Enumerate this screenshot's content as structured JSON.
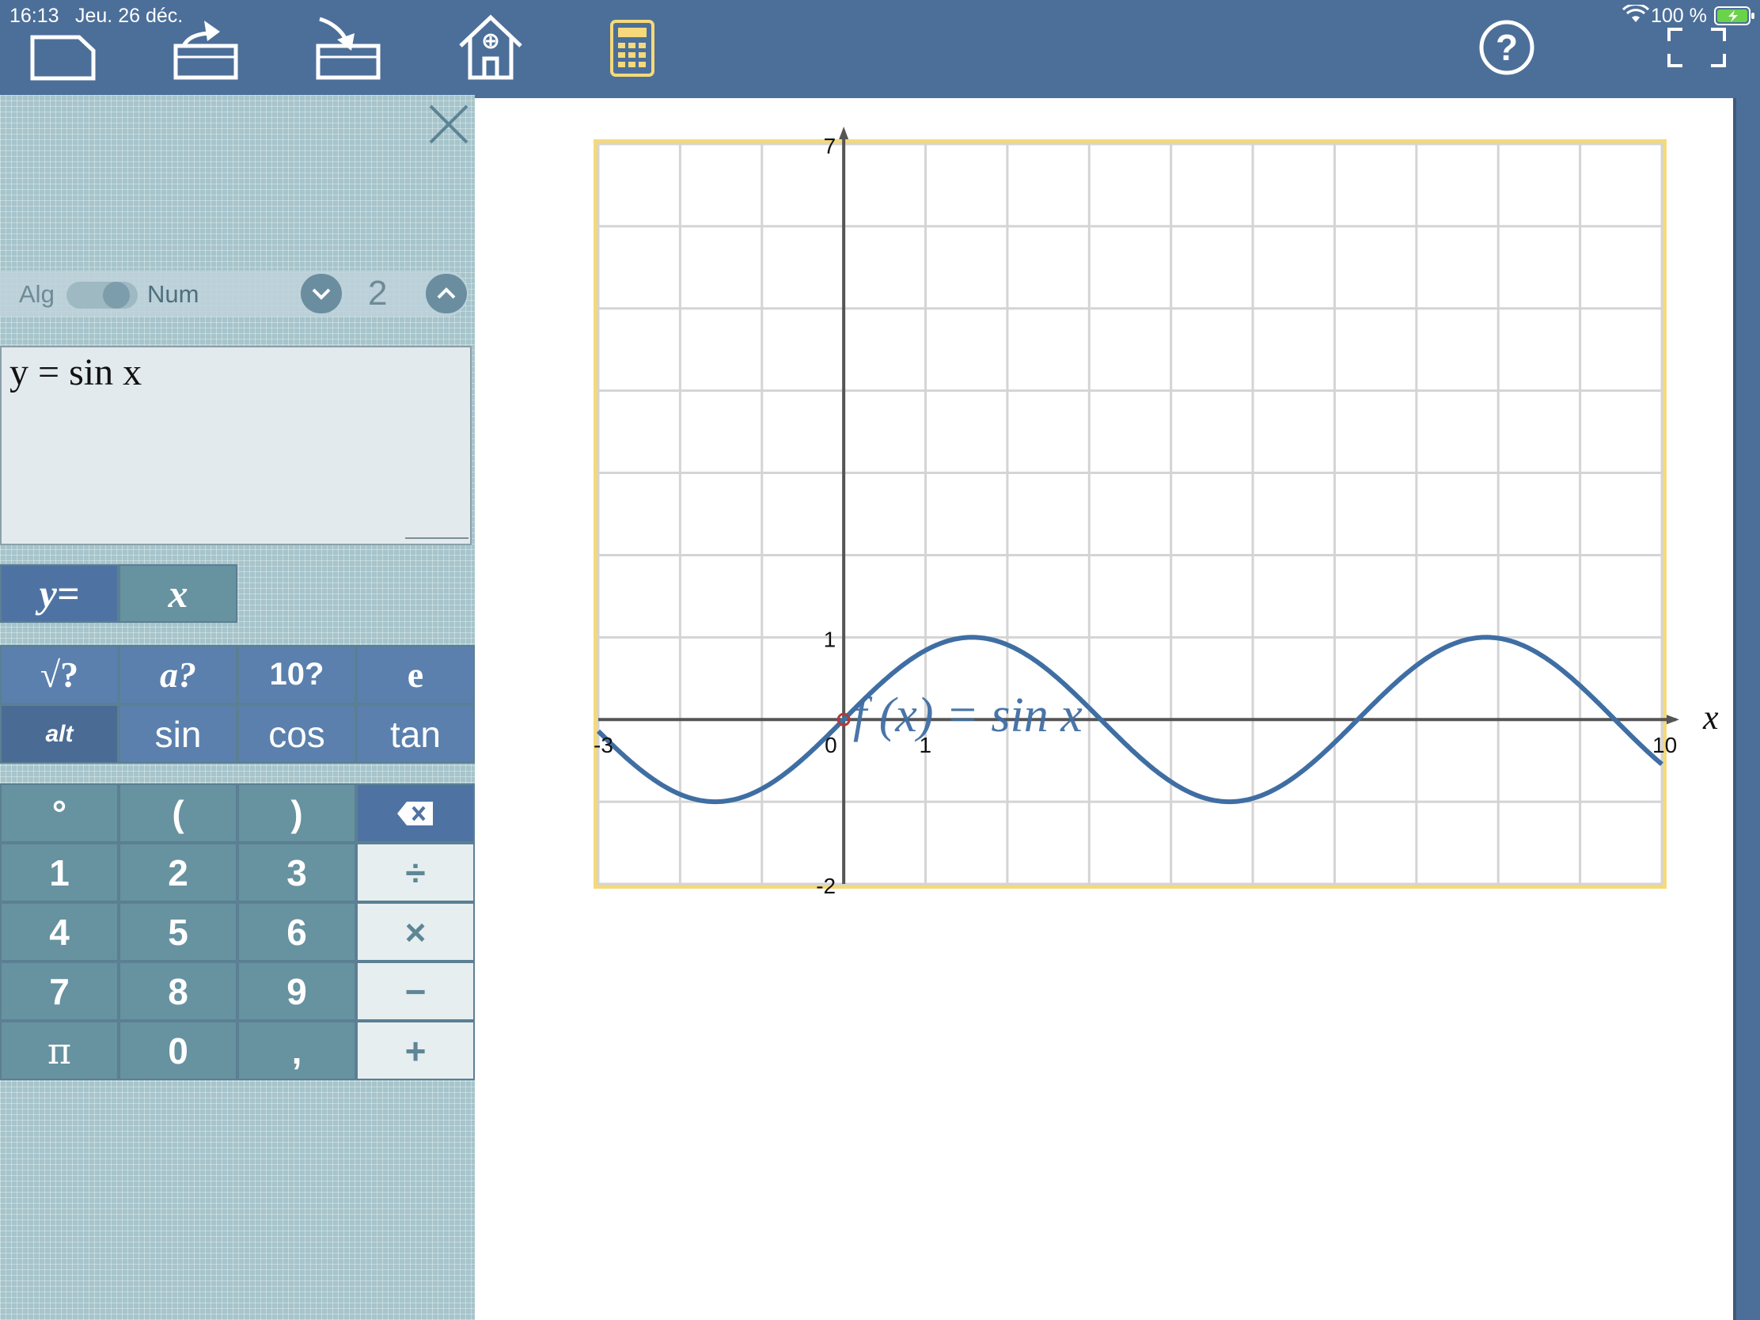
{
  "status_bar": {
    "time": "16:13",
    "date": "Jeu. 26 déc.",
    "battery": "100 %"
  },
  "toolbar": {
    "buttons": [
      "new-document",
      "export",
      "import",
      "home",
      "calculator",
      "help",
      "fullscreen"
    ],
    "help_glyph": "?"
  },
  "panel": {
    "mode_left": "Alg",
    "mode_right": "Num",
    "precision": "2",
    "expression": "y = sin x",
    "var_tabs": [
      "y=",
      "x"
    ]
  },
  "keypad": {
    "functions_row1": [
      "√?",
      "a?",
      "10?",
      "e"
    ],
    "functions_row2": [
      "alt",
      "sin",
      "cos",
      "tan"
    ],
    "rows": [
      [
        "°",
        "(",
        ")",
        "⌫"
      ],
      [
        "1",
        "2",
        "3",
        "÷"
      ],
      [
        "4",
        "5",
        "6",
        "×"
      ],
      [
        "7",
        "8",
        "9",
        "−"
      ],
      [
        "π",
        "0",
        ",",
        "+"
      ]
    ]
  },
  "chart_data": {
    "type": "line",
    "xlabel": "x",
    "xlim": [
      -3,
      10
    ],
    "ylim": [
      -2,
      7
    ],
    "x_tick_labels": [
      "-3",
      "0",
      "1",
      "10"
    ],
    "y_tick_labels": [
      "7",
      "1",
      "-2"
    ],
    "grid": true,
    "frame_color": "#f5d97a",
    "series": [
      {
        "name": "f (x) = sin x",
        "function": "sin",
        "color": "#3f6ea3"
      }
    ],
    "annotation": "f (x) = sin x"
  }
}
